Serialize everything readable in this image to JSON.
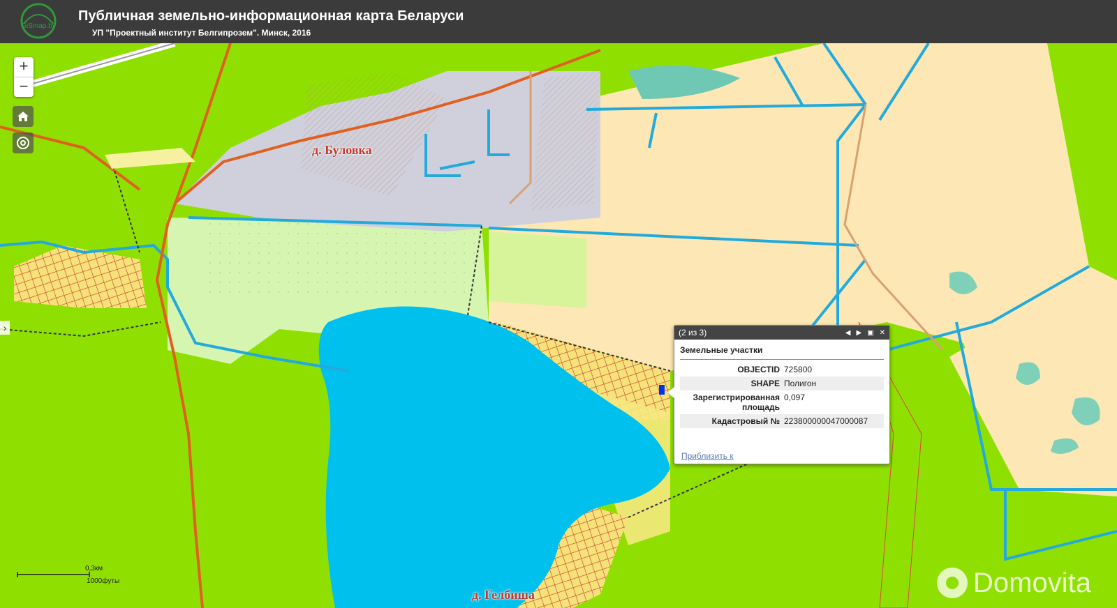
{
  "header": {
    "title": "Публичная земельно-информационная карта Беларуси",
    "subtitle": "УП \"Проектный институт Белгипрозем\". Минск, 2016",
    "logo_text": "GiSmap.by"
  },
  "map": {
    "zoom_in": "+",
    "zoom_out": "−",
    "labels": {
      "village_1": "д. Буловка",
      "village_2": "д. Гелбиша"
    },
    "icons": [
      "home-icon",
      "locate-icon",
      "expand-arrow-icon"
    ]
  },
  "popup": {
    "count": "(2 из 3)",
    "prev": "◀",
    "next": "▶",
    "maximize": "▣",
    "close": "✕",
    "layer_title": "Земельные участки",
    "attributes": [
      {
        "key": "OBJECTID",
        "value": "725800"
      },
      {
        "key": "SHAPE",
        "value": "Полигон"
      },
      {
        "key": "Зарегистрированная площадь",
        "value": "0,097"
      },
      {
        "key": "Кадастровый №",
        "value": "223800000047000087"
      }
    ],
    "zoom_link": "Приблизить к"
  },
  "scale": {
    "km": "0,3км",
    "ft": "1000футы"
  },
  "watermark": "Domovita",
  "colors": {
    "forest": "#8fe000",
    "field": "#fde7b4",
    "water": "#00c0ee",
    "settlement": "#c8c8d8",
    "road": "#e06020",
    "stream": "#22aadd"
  }
}
